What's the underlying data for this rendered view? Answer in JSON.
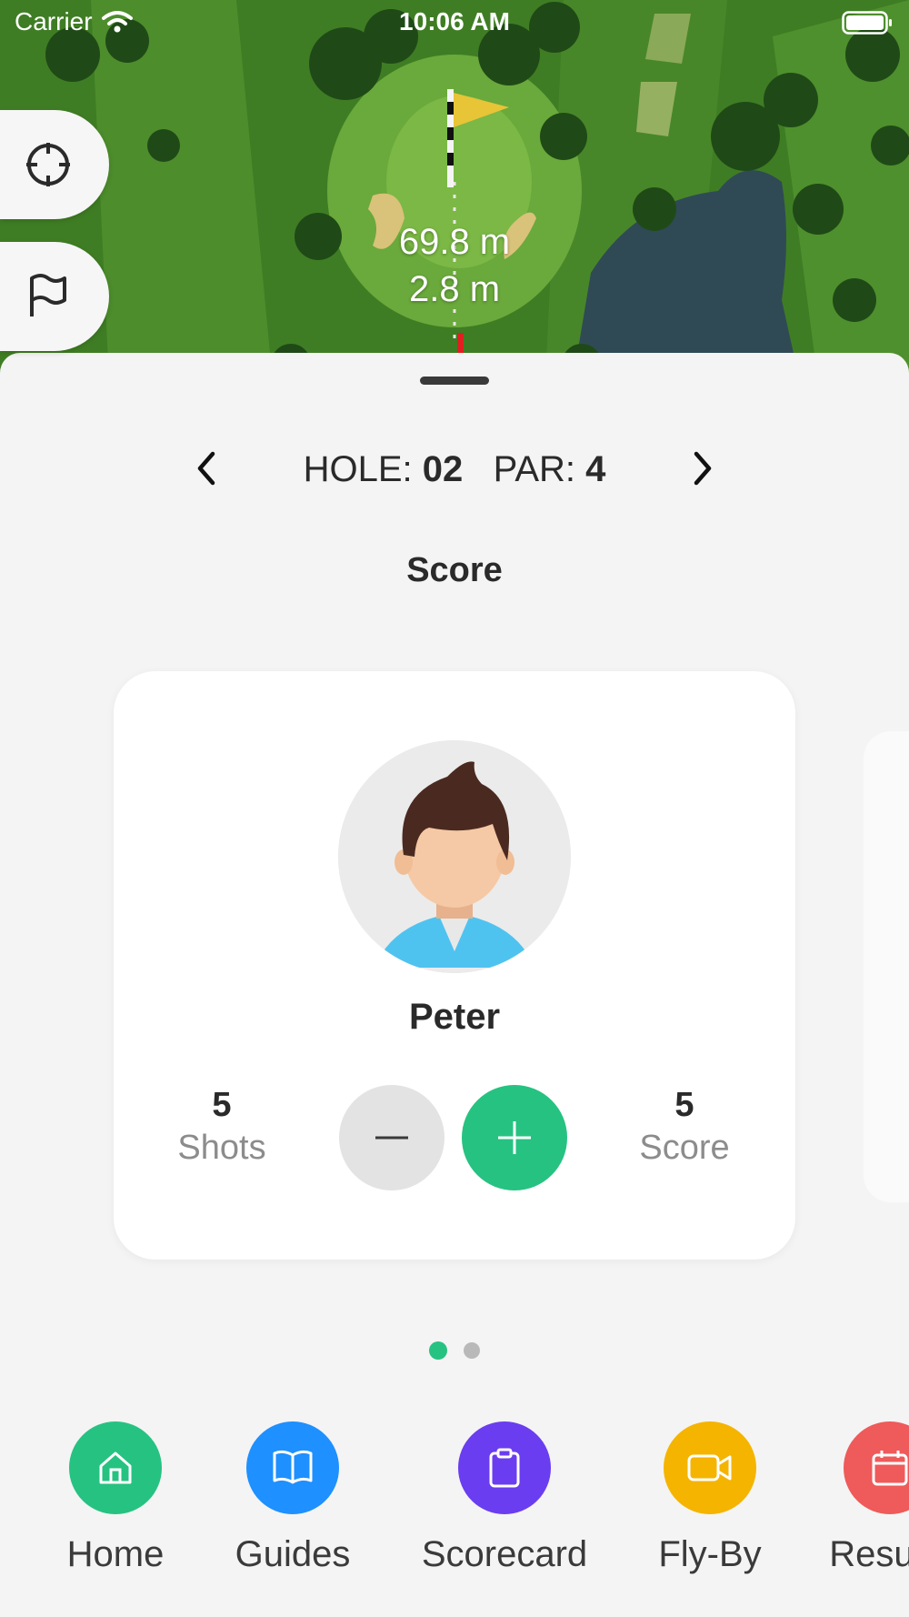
{
  "status_bar": {
    "carrier": "Carrier",
    "time": "10:06 AM"
  },
  "map": {
    "distance_to_pin": "69.8 m",
    "distance_secondary": "2.8 m"
  },
  "hole_nav": {
    "hole_label": "HOLE:",
    "hole_number": "02",
    "par_label": "PAR:",
    "par_value": "4"
  },
  "score_section": {
    "title": "Score"
  },
  "player_card": {
    "name": "Peter",
    "shots_value": "5",
    "shots_label": "Shots",
    "score_value": "5",
    "score_label": "Score"
  },
  "pager": {
    "page_count": 2,
    "active_index": 0
  },
  "bottom_nav": {
    "items": [
      {
        "label": "Home",
        "icon": "home-icon",
        "color": "#26c281"
      },
      {
        "label": "Guides",
        "icon": "book-icon",
        "color": "#1e90ff"
      },
      {
        "label": "Scorecard",
        "icon": "clipboard-icon",
        "color": "#6a3df0"
      },
      {
        "label": "Fly-By",
        "icon": "video-camera-icon",
        "color": "#f5b400"
      },
      {
        "label": "Results",
        "icon": "calendar-icon",
        "color": "#ef5a5a"
      }
    ]
  },
  "colors": {
    "accent_green": "#26c281",
    "dot_inactive": "#b9b9b9"
  }
}
